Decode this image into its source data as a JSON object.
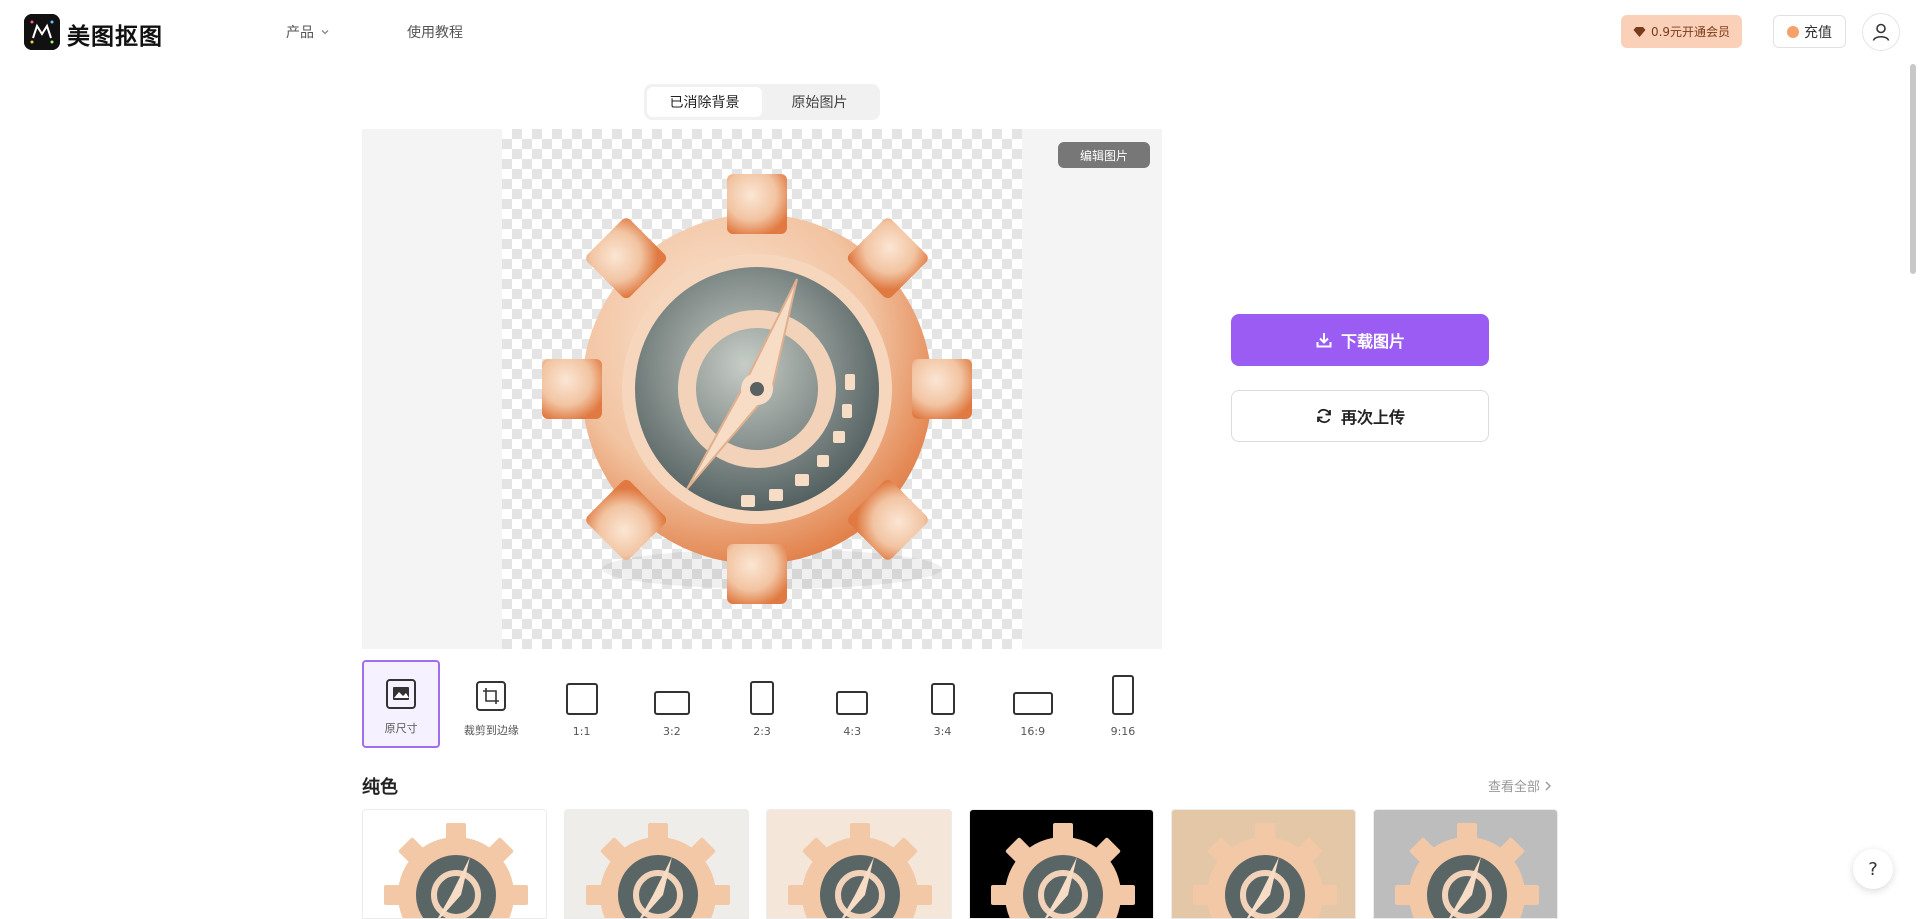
{
  "header": {
    "brand": "美图抠图",
    "nav_product": "产品",
    "nav_tutorial": "使用教程",
    "vip_label": "0.9元开通会员",
    "recharge_label": "充值"
  },
  "view_toggle": {
    "tabs": [
      {
        "label": "已消除背景",
        "active": true
      },
      {
        "label": "原始图片",
        "active": false
      }
    ]
  },
  "preview": {
    "edit_label": "编辑图片"
  },
  "ratios": [
    {
      "label": "原尺寸",
      "active": true
    },
    {
      "label": "裁剪到边缘",
      "active": false
    },
    {
      "label": "1:1",
      "active": false
    },
    {
      "label": "3:2",
      "active": false
    },
    {
      "label": "2:3",
      "active": false
    },
    {
      "label": "4:3",
      "active": false
    },
    {
      "label": "3:4",
      "active": false
    },
    {
      "label": "16:9",
      "active": false
    },
    {
      "label": "9:16",
      "active": false
    }
  ],
  "backgrounds": {
    "title": "纯色",
    "view_all": "查看全部",
    "swatch_colors": [
      "#ffffff",
      "#efedea",
      "#f5e6da",
      "#000000",
      "#e3c7a6",
      "#bdbdbd"
    ]
  },
  "actions": {
    "download_label": "下载图片",
    "reupload_label": "再次上传"
  },
  "help": {
    "label": "?"
  },
  "colors": {
    "accent": "#9a5cf2",
    "vip_bg": "#fbd0b8"
  }
}
